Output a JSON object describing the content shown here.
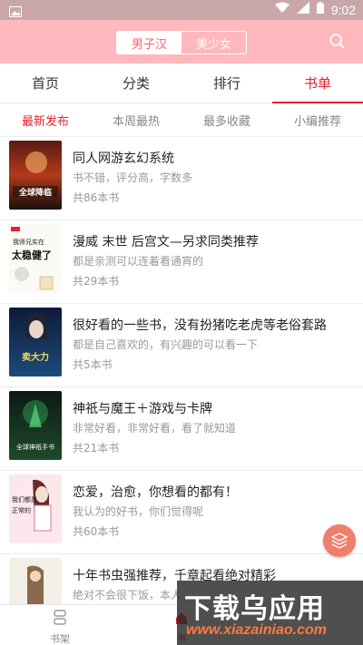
{
  "status_bar": {
    "time": "9:02"
  },
  "header": {
    "gender_options": [
      "男子汉",
      "美少女"
    ],
    "selected_gender": "男子汉"
  },
  "tabs": [
    {
      "label": "首页"
    },
    {
      "label": "分类"
    },
    {
      "label": "排行"
    },
    {
      "label": "书单"
    }
  ],
  "active_tab": "书单",
  "subtabs": [
    {
      "label": "最新发布"
    },
    {
      "label": "本周最热"
    },
    {
      "label": "最多收藏"
    },
    {
      "label": "小编推荐"
    }
  ],
  "active_subtab": "最新发布",
  "booklists": [
    {
      "title": "同人网游玄幻系统",
      "desc": "书不错，评分高，字数多",
      "count": "共86本书",
      "cover_text": "全球降临"
    },
    {
      "title": "漫威 末世 后宫文—另求同类推荐",
      "desc": "都是亲测可以连着看通宵的",
      "count": "共29本书",
      "cover_text": "我师兄实在太稳健了"
    },
    {
      "title": "很好看的一些书，没有扮猪吃老虎等老俗套路",
      "desc": "都是自己喜欢的，有兴趣的可以看一下",
      "count": "共5本书",
      "cover_text": "开局送我卖大力"
    },
    {
      "title": "神祇与魔王＋游戏与卡牌",
      "desc": "非常好看，非常好看，看了就知道",
      "count": "共21本书",
      "cover_text": "全球神祇手书"
    },
    {
      "title": "恋爱，治愈，你想看的都有！",
      "desc": "我认为的好书，你们觉得呢",
      "count": "共60本书",
      "cover_text": "我们都是正常的游戏"
    },
    {
      "title": "十年书虫强推荐，千章起看绝对精彩",
      "desc": "绝对不会很下饭，本人",
      "count": "",
      "cover_text": ""
    }
  ],
  "bottom_nav": [
    {
      "label": "书架"
    },
    {
      "label": "书"
    }
  ],
  "watermark": {
    "line1": "下载乌应用",
    "line2": "www.xiazainiao.com"
  },
  "colors": {
    "accent": "#e5222f",
    "header_bg": "#ffb8bd",
    "fab": "#ef7e6a"
  }
}
